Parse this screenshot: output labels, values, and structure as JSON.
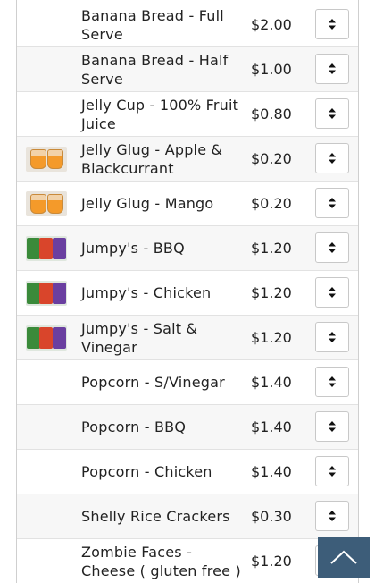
{
  "products": [
    {
      "name": "Banana Bread - Full Serve",
      "price": "$2.00",
      "image": null
    },
    {
      "name": "Banana Bread - Half Serve",
      "price": "$1.00",
      "image": null
    },
    {
      "name": "Jelly Cup - 100% Fruit Juice",
      "price": "$0.80",
      "image": null
    },
    {
      "name": "Jelly Glug - Apple & Blackcurrant",
      "price": "$0.20",
      "image": "jelly-cups-photo"
    },
    {
      "name": "Jelly Glug - Mango",
      "price": "$0.20",
      "image": "jelly-cups-photo"
    },
    {
      "name": "Jumpy's - BBQ",
      "price": "$1.20",
      "image": "chip-bags-photo"
    },
    {
      "name": "Jumpy's - Chicken",
      "price": "$1.20",
      "image": "chip-bags-photo"
    },
    {
      "name": "Jumpy's - Salt & Vinegar",
      "price": "$1.20",
      "image": "chip-bags-photo"
    },
    {
      "name": "Popcorn - S/Vinegar",
      "price": "$1.40",
      "image": null
    },
    {
      "name": "Popcorn - BBQ",
      "price": "$1.40",
      "image": null
    },
    {
      "name": "Popcorn - Chicken",
      "price": "$1.40",
      "image": null
    },
    {
      "name": "Shelly Rice Crackers",
      "price": "$0.30",
      "image": null
    },
    {
      "name": "Zombie Faces - Cheese ( gluten free )",
      "price": "$1.20",
      "image": null
    }
  ],
  "icons": {
    "quantity_stepper": "up-down-arrows-icon",
    "scroll_top": "chevron-up-icon"
  },
  "colors": {
    "scroll_top_bg": "#3d5d79",
    "row_alt_bg": "#f7f7f7",
    "border": "#cfcfcf"
  }
}
